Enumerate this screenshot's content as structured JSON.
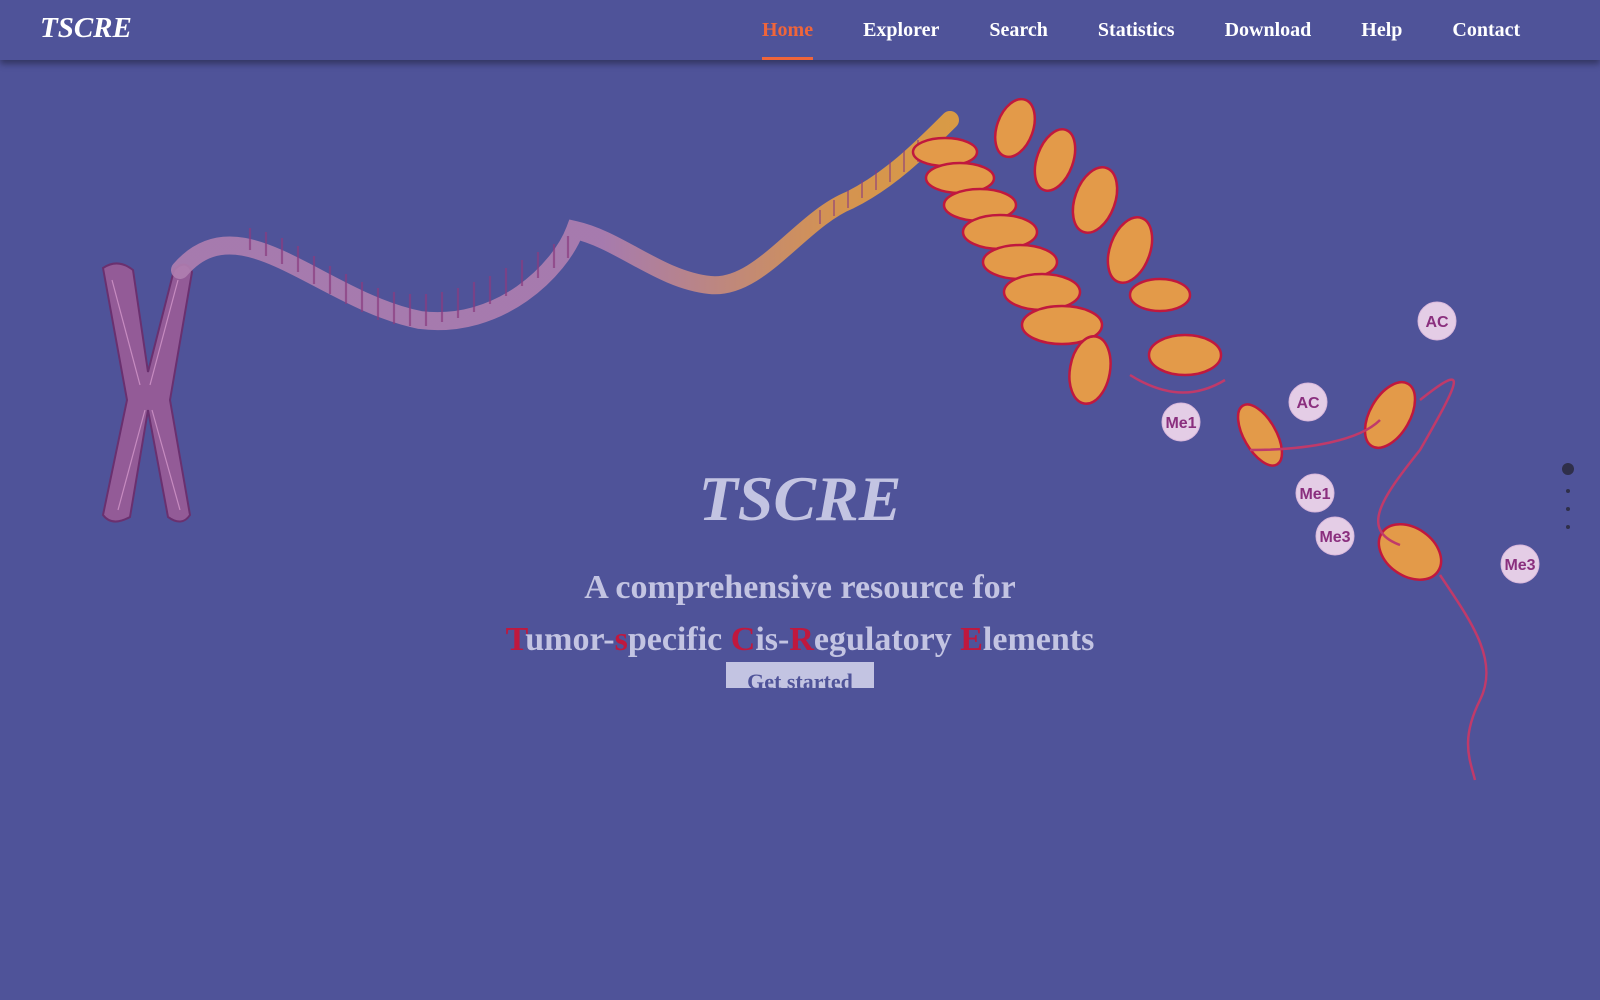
{
  "header": {
    "brand": "TSCRE",
    "nav": [
      {
        "label": "Home",
        "active": true
      },
      {
        "label": "Explorer"
      },
      {
        "label": "Search"
      },
      {
        "label": "Statistics"
      },
      {
        "label": "Download"
      },
      {
        "label": "Help"
      },
      {
        "label": "Contact"
      }
    ]
  },
  "hero": {
    "title": "TSCRE",
    "line1": "A comprehensive resource for",
    "line2_parts": [
      {
        "text": "T",
        "highlight": true
      },
      {
        "text": "umor-",
        "highlight": false
      },
      {
        "text": "s",
        "highlight": true
      },
      {
        "text": "pecific ",
        "highlight": false
      },
      {
        "text": "C",
        "highlight": true
      },
      {
        "text": "is-",
        "highlight": false
      },
      {
        "text": "R",
        "highlight": true
      },
      {
        "text": "egulatory ",
        "highlight": false
      },
      {
        "text": "E",
        "highlight": true
      },
      {
        "text": "lements",
        "highlight": false
      }
    ],
    "cta_label": "Get started"
  },
  "illustration": {
    "histone_marks": [
      "AC",
      "AC",
      "Me1",
      "Me1",
      "Me3",
      "Me3"
    ]
  },
  "carousel": {
    "slides": 4,
    "active_index": 0
  },
  "colors": {
    "background": "#4f5399",
    "active_nav": "#f0653a",
    "highlight_letter": "#c0183e",
    "hero_text": "#c3c4e2",
    "chromosome": "#a5679f",
    "nucleosome": "#e39a49"
  }
}
